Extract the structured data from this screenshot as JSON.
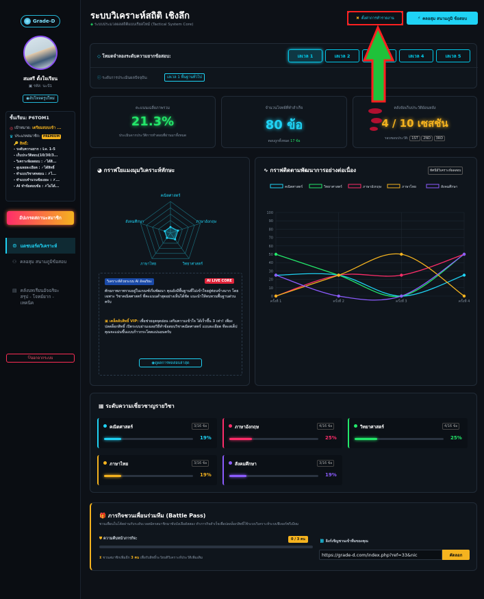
{
  "sidebar": {
    "logo_text": "Grade-D",
    "user_name": "สมศรี ตั้งใจเรียน",
    "user_sub": "รหัส: นะปั1",
    "change_avatar": "อัปโหลดรูปใหม่",
    "class_label": "ชั้นเรียน: P6TOM1",
    "goal_label": "เป้าหมาย:",
    "goal_value": "เตรียมสอบเข้า ...",
    "plan_label": "ประเภทสมาชิก:",
    "plan_badge": "PREMIUM",
    "perks_title": "สิทธิ์:",
    "perks": [
      "- ระดับความยาก : Lv. 1-5",
      "- เก็บประวัติสอบ(10/30/3...",
      "- วิเคราะห์ผลสอบ : ✓ได้สิ...",
      "- ดูเฉลยละเอียด : ✓ได้สิทธิ์",
      "- ทำแบบวิชาสหสอน : ✗ไ...",
      "- ทำแบบจำนวนข้อเยอะ : ✗...",
      "- AI ทำข้อสอบข้อ : ✗ไม่ได้..."
    ],
    "upgrade_button": "อัปเกรดสถานะสมาชิก",
    "nav": [
      {
        "label": "แดชบอร์ดวิเคราะห์",
        "active": true
      },
      {
        "label": "คลอสุม สนามภูมิข้อสอบ",
        "active": false
      },
      {
        "label": "คลังบทเรียนอัจฉริยะ สรุป - โจทย์ยาก - เทคนิค",
        "active": false
      }
    ],
    "logout": "ออกจากระบบ"
  },
  "header": {
    "title": "ระบบวิเคราะห์สถิติ เชิงลึก",
    "subtitle": "ระบบประมวลผลสถิติแบบเรียลไทม์ (Tactical System Core)",
    "manage_button": "ตั้งค่าการทำรายงาน",
    "arena_button": "คลอสุม สนามภูมิ ข้อสอบ"
  },
  "levels": {
    "title": "โหมดจำลองระดับความยากข้อสอบ:",
    "items": [
      "เลเวล 1",
      "เลเวล 2",
      "เลเวล 3",
      "เลเวล 4",
      "เลเวล 5"
    ],
    "current_label": "ระดับการประเมินผลปัจจุบัน:",
    "current_badge": "เลเวล 1 พื้นฐานทั่วไป"
  },
  "stats": [
    {
      "label": "คะแนนเฉลี่ยภาพรวม",
      "value": "21.3%",
      "sub": "ประเมินจากประวัติการทำสอบที่ผ่านมาทั้งหมด",
      "color": "#23e86a"
    },
    {
      "label": "จำนวนโจทย์ที่ทำสำเร็จ",
      "value": "80 ข้อ",
      "sub": "ตอบถูกทั้งหมด",
      "sub2": "17 ข้อ",
      "color": "#1fd3f5"
    },
    {
      "label": "คลังจัดเก็บประวัติย้อนหลัง",
      "value": "4 / 10 เซสชัน",
      "sub": "รอบขอบประวัติ:",
      "chips": [
        "1ST",
        "2ND",
        "3RD"
      ],
      "color": "#f5b31f"
    }
  ],
  "radar": {
    "title": "กราฟใยแมงมุมวิเคราะห์ทักษะ",
    "axes": [
      "คณิตศาสตร์",
      "ภาษาอังกฤษ",
      "วิทยาศาสตร์",
      "ภาษาไทย",
      "สังคมศึกษา"
    ],
    "values": [
      19,
      25,
      25,
      19,
      19
    ],
    "ai_badge": "วิเคราะห์ด้วยระบบ AI อัจฉริยะ",
    "ai_live": "AI LIVE CORE",
    "ai_text": "ศักยภาพภาพรวมอยู่ในเกณฑ์เริ่มพัฒนา คุณยังมีพื้นฐานที่ไม่เข้าใจอยู่ค่อนข้างมาก โดยเฉพาะ วิชาคณิตศาสตร์ ที่คะแนนต่ำสุดอย่างเห็นได้ชัด แนะนำให้ทบทวนพื้นฐานด่วนครับ",
    "vip_label": "เคล็ดลับสิทธิ์ VIP:",
    "vip_text": "เพื่อช่วยอุดจุดอ่อน เสริมความเข้าใจ ได้เร็วขึ้น 3 เท่า! เพียงปลดล็อกสิทธิ์ เปิดระบบอ่านเฉลยวิธีทำข้อสอบวิชาคณิตศาสตร์ แบบละเอียด ทีละสเต็ป คุณจะแม่นขึ้นแบบก้าวกระโดดแน่นอนครับ",
    "view_button": "ดูผลการทดสอบล่าสุด"
  },
  "trend": {
    "title": "กราฟติดตามพัฒนาการอย่างต่อเนื่อง",
    "badge": "ทัศนีย์วิเคราะห์ผลสอบ"
  },
  "chart_data": {
    "type": "line",
    "x": [
      "ครั้งที่ 1",
      "ครั้งที่ 2",
      "ครั้งที่ 3",
      "ครั้งที่ 4"
    ],
    "ylim": [
      0,
      100
    ],
    "yticks": [
      0,
      10,
      20,
      30,
      40,
      50,
      60,
      70,
      80,
      90,
      100
    ],
    "series": [
      {
        "name": "คณิตศาสตร์",
        "color": "#1fd3f5",
        "values": [
          25,
          25,
          0,
          25
        ]
      },
      {
        "name": "วิทยาศาสตร์",
        "color": "#23e86a",
        "values": [
          50,
          25,
          0,
          50
        ]
      },
      {
        "name": "ภาษาอังกฤษ",
        "color": "#ff2d6a",
        "values": [
          0,
          25,
          25,
          50
        ]
      },
      {
        "name": "ภาษาไทย",
        "color": "#f5b31f",
        "values": [
          0,
          25,
          50,
          0
        ]
      },
      {
        "name": "สังคมศึกษา",
        "color": "#8c5cff",
        "values": [
          25,
          0,
          0,
          50
        ]
      }
    ]
  },
  "subjects": {
    "title": "ระดับความเชี่ยวชาญรายวิชา",
    "items": [
      {
        "name": "คณิตศาสตร์",
        "count": "3/16 ข้อ",
        "pct": "19%",
        "value": 19,
        "color": "#1fd3f5"
      },
      {
        "name": "ภาษาอังกฤษ",
        "count": "4/16 ข้อ",
        "pct": "25%",
        "value": 25,
        "color": "#ff2d6a"
      },
      {
        "name": "วิทยาศาสตร์",
        "count": "4/16 ข้อ",
        "pct": "25%",
        "value": 25,
        "color": "#23e86a"
      },
      {
        "name": "ภาษาไทย",
        "count": "3/16 ข้อ",
        "pct": "19%",
        "value": 19,
        "color": "#f5b31f"
      },
      {
        "name": "สังคมศึกษา",
        "count": "3/16 ข้อ",
        "pct": "19%",
        "value": 19,
        "color": "#8c5cff"
      }
    ]
  },
  "battle": {
    "title": "ภารกิจชวนเพื่อนร่วมทีม (Battle Pass)",
    "subtitle": "ชวนเพื่อนในโค้ดผ่านกับระดับเวลสมัครสมาชิกมาขับบังเลือดัสสอง ทำภารกิจสำเร็จเพื่อปลดล็อกสิทธิ์ใช้ระบบวิเคราะห์ระบบฟีเจอร์พรีเมียม",
    "progress_label": "ความคืบหน้าภารกิจ:",
    "progress_badge": "0 / 3 คน",
    "progress_value": 0,
    "hint_prefix": "ชวนสมาชิกเพิ่มอีก",
    "hint_count": "3 คน",
    "hint_suffix": "เพื่อรับสิทธิ์ระวัยบติวิเคราะห์ประวัติเพิ่มเติม",
    "link_label": "ลิงก์เชิญชวนเข้าทีมของคุณ",
    "link_value": "https://grade-d.com/index.php?ref=33&nic",
    "copy_button": "คัดลอก"
  }
}
